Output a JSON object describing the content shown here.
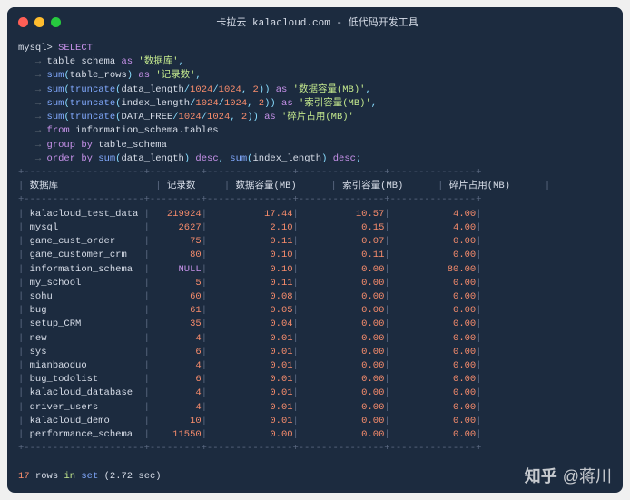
{
  "window": {
    "title": "卡拉云 kalacloud.com - 低代码开发工具"
  },
  "query": {
    "prompt": "mysql>",
    "cont": "   →",
    "keywords": {
      "select": "SELECT",
      "as1": "as",
      "as2": "as",
      "as3": "as",
      "as4": "as",
      "as5": "as",
      "from": "from",
      "group_by": "group by",
      "order_by": "order by",
      "desc1": "desc",
      "desc2": "desc"
    },
    "idents": {
      "table_schema": "table_schema",
      "table_rows": "table_rows",
      "data_length": "data_length",
      "index_length": "index_length",
      "data_free": "DATA_FREE",
      "source": "information_schema.tables"
    },
    "funcs": {
      "sum": "sum",
      "truncate": "truncate"
    },
    "nums": {
      "k1": "1024",
      "k2": "1024",
      "two": "2"
    },
    "strings": {
      "db": "'数据库'",
      "rows": "'记录数'",
      "data_mb": "'数据容量(MB)'",
      "idx_mb": "'索引容量(MB)'",
      "frag_mb": "'碎片占用(MB)'"
    }
  },
  "table": {
    "headers": [
      "数据库",
      "记录数",
      "数据容量(MB)",
      "索引容量(MB)",
      "碎片占用(MB)"
    ],
    "rows": [
      {
        "db": "kalacloud_test_data",
        "rows": "219924",
        "data": "17.44",
        "idx": "10.57",
        "frag": "4.00"
      },
      {
        "db": "mysql",
        "rows": "2627",
        "data": "2.10",
        "idx": "0.15",
        "frag": "4.00"
      },
      {
        "db": "game_cust_order",
        "rows": "75",
        "data": "0.11",
        "idx": "0.07",
        "frag": "0.00"
      },
      {
        "db": "game_customer_crm",
        "rows": "80",
        "data": "0.10",
        "idx": "0.11",
        "frag": "0.00"
      },
      {
        "db": "information_schema",
        "rows": "NULL",
        "data": "0.10",
        "idx": "0.00",
        "frag": "80.00"
      },
      {
        "db": "my_school",
        "rows": "5",
        "data": "0.11",
        "idx": "0.00",
        "frag": "0.00"
      },
      {
        "db": "sohu",
        "rows": "60",
        "data": "0.08",
        "idx": "0.00",
        "frag": "0.00"
      },
      {
        "db": "bug",
        "rows": "61",
        "data": "0.05",
        "idx": "0.00",
        "frag": "0.00"
      },
      {
        "db": "setup_CRM",
        "rows": "35",
        "data": "0.04",
        "idx": "0.00",
        "frag": "0.00"
      },
      {
        "db": "new",
        "rows": "4",
        "data": "0.01",
        "idx": "0.00",
        "frag": "0.00"
      },
      {
        "db": "sys",
        "rows": "6",
        "data": "0.01",
        "idx": "0.00",
        "frag": "0.00"
      },
      {
        "db": "mianbaoduo",
        "rows": "4",
        "data": "0.01",
        "idx": "0.00",
        "frag": "0.00"
      },
      {
        "db": "bug_todolist",
        "rows": "6",
        "data": "0.01",
        "idx": "0.00",
        "frag": "0.00"
      },
      {
        "db": "kalacloud_database",
        "rows": "4",
        "data": "0.01",
        "idx": "0.00",
        "frag": "0.00"
      },
      {
        "db": "driver_users",
        "rows": "4",
        "data": "0.01",
        "idx": "0.00",
        "frag": "0.00"
      },
      {
        "db": "kalacloud_demo",
        "rows": "10",
        "data": "0.01",
        "idx": "0.00",
        "frag": "0.00"
      },
      {
        "db": "performance_schema",
        "rows": "11550",
        "data": "0.00",
        "idx": "0.00",
        "frag": "0.00"
      }
    ]
  },
  "summary": {
    "count": "17",
    "rows_word": "rows",
    "in_word": "in",
    "set_word": "set",
    "time": "(2.72 sec)"
  },
  "watermark": {
    "site": "知乎",
    "at": "@蒋川"
  }
}
